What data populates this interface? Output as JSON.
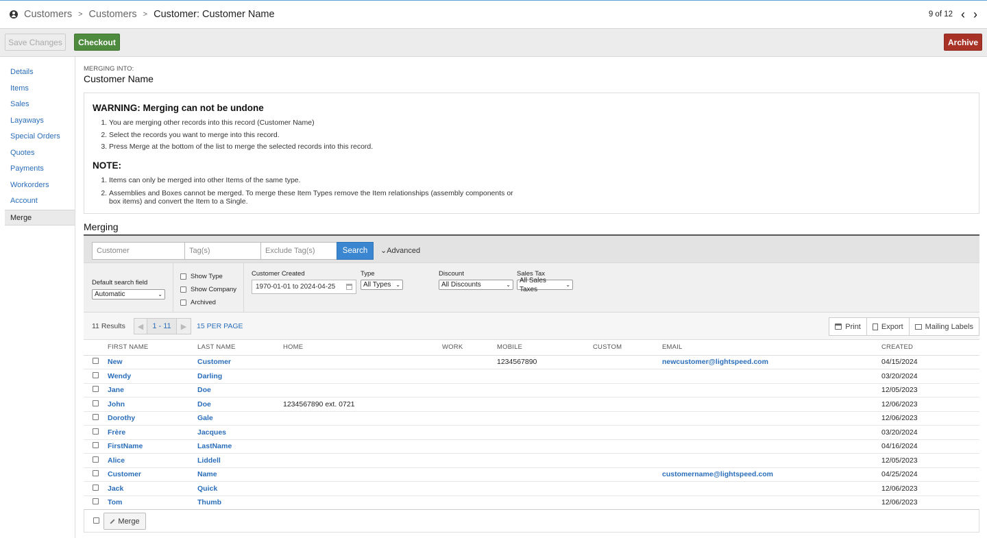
{
  "breadcrumb": {
    "items": [
      "Customers",
      "Customers"
    ],
    "current": "Customer:  Customer Name"
  },
  "pager": {
    "label": "9 of 12"
  },
  "toolbar": {
    "save_label": "Save Changes",
    "checkout_label": "Checkout",
    "archive_label": "Archive"
  },
  "sidebar": {
    "items": [
      {
        "label": "Details"
      },
      {
        "label": "Items"
      },
      {
        "label": "Sales"
      },
      {
        "label": "Layaways"
      },
      {
        "label": "Special Orders"
      },
      {
        "label": "Quotes"
      },
      {
        "label": "Payments"
      },
      {
        "label": "Workorders"
      },
      {
        "label": "Account"
      },
      {
        "label": "Merge"
      }
    ],
    "active": "Merge"
  },
  "main": {
    "merging_into_label": "MERGING INTO:",
    "merging_into_name": "Customer Name",
    "warning_title": "WARNING: Merging can not be undone",
    "warning_steps": [
      "You are merging other records into this record (Customer Name)",
      "Select the records you want to merge into this record.",
      "Press Merge at the bottom of the list to merge the selected records into this record."
    ],
    "note_title": "NOTE:",
    "note_items": [
      "Items can only be merged into other Items of the same type.",
      "Assemblies and Boxes cannot be merged. To merge these Item Types remove the Item relationships (assembly components or box items) and convert the Item to a Single."
    ],
    "merging_title": "Merging"
  },
  "search": {
    "customer_placeholder": "Customer",
    "tags_placeholder": "Tag(s)",
    "exclude_tags_placeholder": "Exclude Tag(s)",
    "search_label": "Search",
    "advanced_label": "Advanced"
  },
  "filters": {
    "default_search_label": "Default search field",
    "default_search_value": "Automatic",
    "show_type": "Show Type",
    "show_company": "Show Company",
    "archived": "Archived",
    "customer_created_label": "Customer Created",
    "customer_created_value": "1970-01-01 to 2024-04-25",
    "type_label": "Type",
    "type_value": "All Types",
    "discount_label": "Discount",
    "discount_value": "All Discounts",
    "sales_tax_label": "Sales Tax",
    "sales_tax_value": "All Sales Taxes"
  },
  "results": {
    "count": "11 Results",
    "page_range": "1 - 11",
    "per_page": "15 PER PAGE",
    "print": "Print",
    "export": "Export",
    "mailing_labels": "Mailing Labels"
  },
  "table": {
    "columns": [
      "FIRST NAME",
      "LAST NAME",
      "HOME",
      "WORK",
      "MOBILE",
      "CUSTOM",
      "EMAIL",
      "CREATED"
    ],
    "rows": [
      {
        "first": "New",
        "last": "Customer",
        "home": "",
        "work": "",
        "mobile": "1234567890",
        "custom": "",
        "email": "newcustomer@lightspeed.com",
        "created": "04/15/2024"
      },
      {
        "first": "Wendy",
        "last": "Darling",
        "home": "",
        "work": "",
        "mobile": "",
        "custom": "",
        "email": "",
        "created": "03/20/2024"
      },
      {
        "first": "Jane",
        "last": "Doe",
        "home": "",
        "work": "",
        "mobile": "",
        "custom": "",
        "email": "",
        "created": "12/05/2023"
      },
      {
        "first": "John",
        "last": "Doe",
        "home": "1234567890 ext. 0721",
        "work": "",
        "mobile": "",
        "custom": "",
        "email": "",
        "created": "12/06/2023"
      },
      {
        "first": "Dorothy",
        "last": "Gale",
        "home": "",
        "work": "",
        "mobile": "",
        "custom": "",
        "email": "",
        "created": "12/06/2023"
      },
      {
        "first": "Frère",
        "last": "Jacques",
        "home": "",
        "work": "",
        "mobile": "",
        "custom": "",
        "email": "",
        "created": "03/20/2024"
      },
      {
        "first": "FirstName",
        "last": "LastName",
        "home": "",
        "work": "",
        "mobile": "",
        "custom": "",
        "email": "",
        "created": "04/16/2024"
      },
      {
        "first": "Alice",
        "last": "Liddell",
        "home": "",
        "work": "",
        "mobile": "",
        "custom": "",
        "email": "",
        "created": "12/05/2023"
      },
      {
        "first": "Customer",
        "last": "Name",
        "home": "",
        "work": "",
        "mobile": "",
        "custom": "",
        "email": "customername@lightspeed.com",
        "created": "04/25/2024"
      },
      {
        "first": "Jack",
        "last": "Quick",
        "home": "",
        "work": "",
        "mobile": "",
        "custom": "",
        "email": "",
        "created": "12/06/2023"
      },
      {
        "first": "Tom",
        "last": "Thumb",
        "home": "",
        "work": "",
        "mobile": "",
        "custom": "",
        "email": "",
        "created": "12/06/2023"
      }
    ]
  },
  "footer": {
    "merge_label": "Merge"
  },
  "colors": {
    "link": "#2a6ebb",
    "checkout": "#4f8b3f",
    "archive": "#a93226",
    "search": "#3a86d1"
  }
}
